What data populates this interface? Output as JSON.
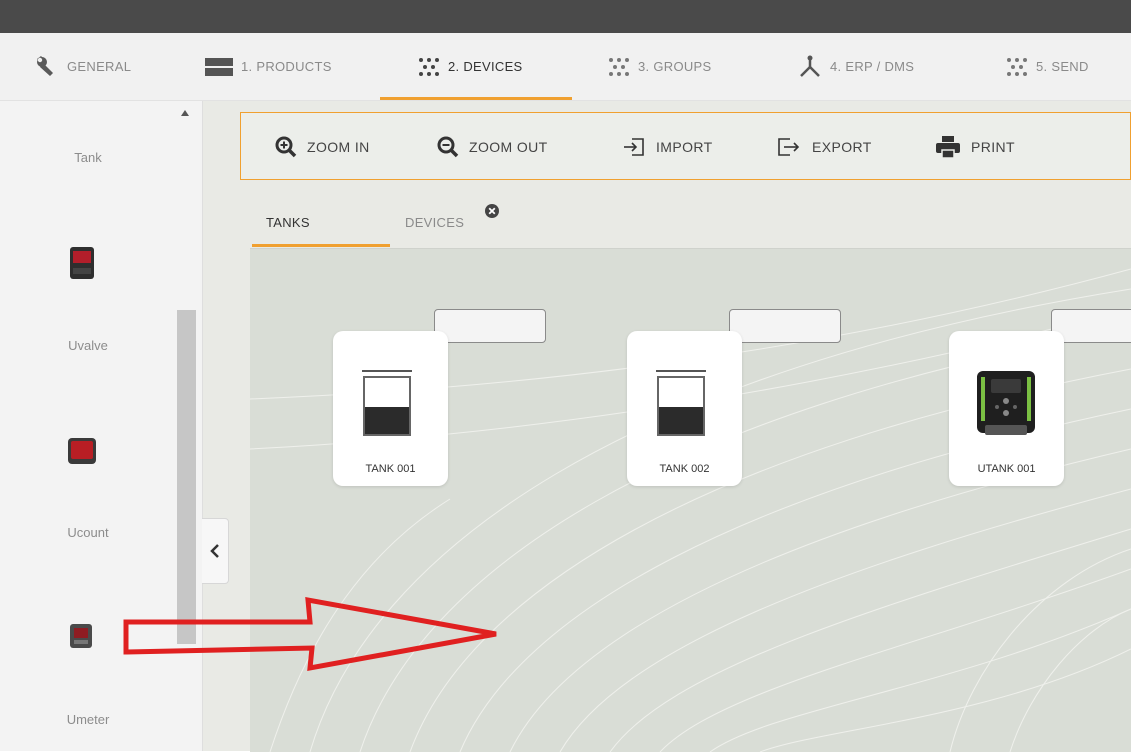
{
  "tabs": [
    {
      "label": "GENERAL",
      "icon": "wrench-icon"
    },
    {
      "label": "1. PRODUCTS",
      "icon": "products-icon"
    },
    {
      "label": "2. DEVICES",
      "icon": "devices-icon",
      "active": true
    },
    {
      "label": "3. GROUPS",
      "icon": "groups-icon"
    },
    {
      "label": "4. ERP / DMS",
      "icon": "erp-icon"
    },
    {
      "label": "5. SEND",
      "icon": "send-icon"
    }
  ],
  "sidebar": {
    "items": [
      {
        "label": "Tank"
      },
      {
        "label": "Uvalve",
        "icon": "uvalve-device-icon"
      },
      {
        "label": "Ucount",
        "icon": "ucount-device-icon"
      },
      {
        "label": "Umeter",
        "icon": "umeter-device-icon"
      }
    ]
  },
  "toolbar": {
    "zoom_in": "ZOOM IN",
    "zoom_out": "ZOOM OUT",
    "import": "IMPORT",
    "export": "EXPORT",
    "print": "PRINT"
  },
  "subtabs": {
    "tanks": "TANKS",
    "devices": "DEVICES"
  },
  "devices": [
    {
      "label": "TANK 001",
      "icon": "tank-icon",
      "name_value": ""
    },
    {
      "label": "TANK 002",
      "icon": "tank-icon",
      "name_value": ""
    },
    {
      "label": "UTANK 001",
      "icon": "utank-device-icon",
      "name_value": ""
    }
  ],
  "colors": {
    "accent": "#f0a030",
    "annotation_arrow": "#e02020",
    "topbar": "#4a4a4a"
  }
}
